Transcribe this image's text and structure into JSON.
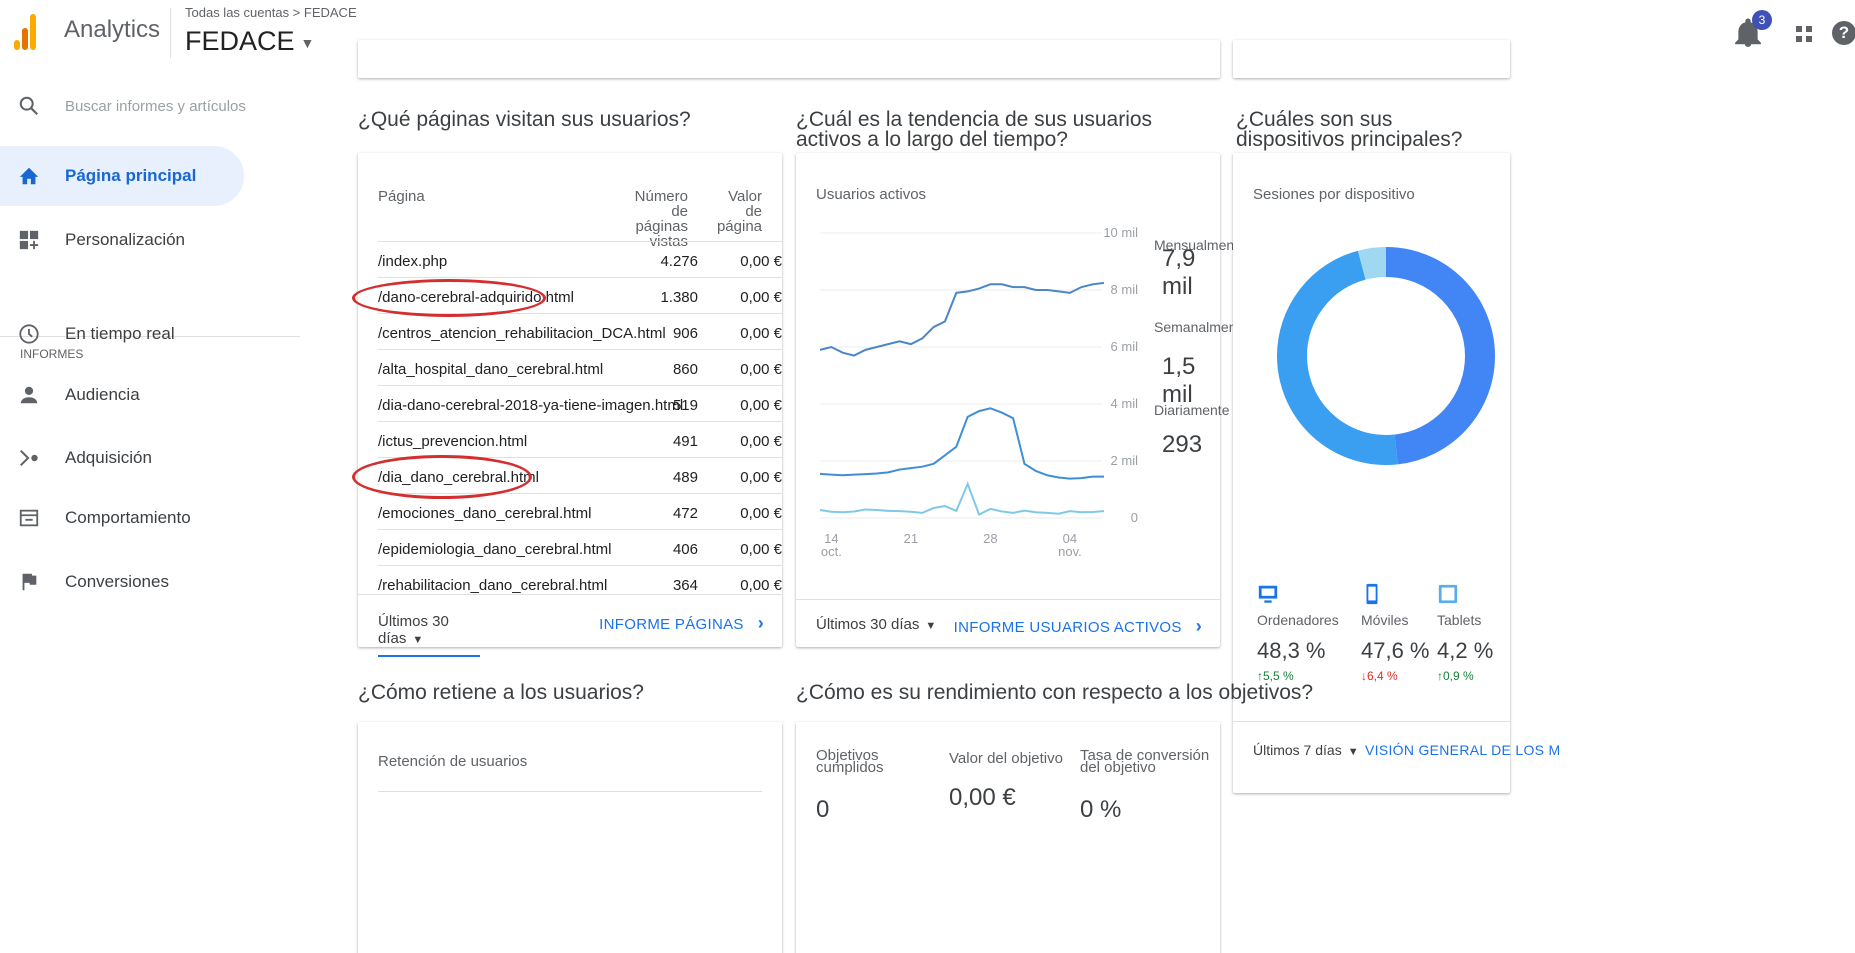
{
  "app": {
    "name": "Analytics",
    "breadcrumb": "Todas las cuentas > FEDACE",
    "account": "FEDACE",
    "notification_count": "3"
  },
  "sidebar": {
    "search_placeholder": "Buscar informes y artículos",
    "items": [
      {
        "label": "Página principal",
        "icon": "home-icon",
        "active": true
      },
      {
        "label": "Personalización",
        "icon": "dashboard-icon"
      }
    ],
    "section_label": "INFORMES",
    "reports": [
      {
        "label": "En tiempo real",
        "icon": "clock-icon"
      },
      {
        "label": "Audiencia",
        "icon": "person-icon"
      },
      {
        "label": "Adquisición",
        "icon": "acquisition-icon"
      },
      {
        "label": "Comportamiento",
        "icon": "behavior-icon"
      },
      {
        "label": "Conversiones",
        "icon": "flag-icon"
      }
    ]
  },
  "pages_card": {
    "question": "¿Qué páginas visitan sus usuarios?",
    "col_page": "Página",
    "col_views": "Número de páginas vistas",
    "col_value": "Valor de página",
    "rows": [
      {
        "page": "/index.php",
        "views": "4.276",
        "value": "0,00 €"
      },
      {
        "page": "/dano-cerebral-adquirido.html",
        "views": "1.380",
        "value": "0,00 €",
        "circled": true
      },
      {
        "page": "/centros_atencion_rehabilitacion_DCA.html",
        "views": "906",
        "value": "0,00 €"
      },
      {
        "page": "/alta_hospital_dano_cerebral.html",
        "views": "860",
        "value": "0,00 €"
      },
      {
        "page": "/dia-dano-cerebral-2018-ya-tiene-imagen.html",
        "views": "519",
        "value": "0,00 €"
      },
      {
        "page": "/ictus_prevencion.html",
        "views": "491",
        "value": "0,00 €"
      },
      {
        "page": "/dia_dano_cerebral.html",
        "views": "489",
        "value": "0,00 €",
        "circled": true
      },
      {
        "page": "/emociones_dano_cerebral.html",
        "views": "472",
        "value": "0,00 €"
      },
      {
        "page": "/epidemiologia_dano_cerebral.html",
        "views": "406",
        "value": "0,00 €"
      },
      {
        "page": "/rehabilitacion_dano_cerebral.html",
        "views": "364",
        "value": "0,00 €"
      }
    ],
    "range": "Últimos 30 días",
    "link": "INFORME PÁGINAS"
  },
  "active_card": {
    "question": "¿Cuál es la tendencia de sus usuarios activos a lo largo del tiempo?",
    "title": "Usuarios activos",
    "y_ticks": [
      "10 mil",
      "8 mil",
      "6 mil",
      "4 mil",
      "2 mil",
      "0"
    ],
    "x_ticks": [
      {
        "day": "14",
        "month": "oct."
      },
      {
        "day": "21",
        "month": ""
      },
      {
        "day": "28",
        "month": ""
      },
      {
        "day": "04",
        "month": "nov."
      }
    ],
    "metrics": [
      {
        "label": "Mensualmente",
        "value": "7,9 mil"
      },
      {
        "label": "Semanalmente",
        "value": "1,5 mil"
      },
      {
        "label": "Diariamente",
        "value": "293"
      }
    ],
    "range": "Últimos 30 días",
    "link": "INFORME USUARIOS ACTIVOS"
  },
  "chart_data": {
    "type": "line",
    "title": "Usuarios activos",
    "ylim": [
      0,
      10000
    ],
    "x": [
      13,
      14,
      15,
      16,
      17,
      18,
      19,
      20,
      21,
      22,
      23,
      24,
      25,
      26,
      27,
      28,
      29,
      30,
      31,
      1,
      2,
      3,
      4,
      5,
      6,
      7
    ],
    "x_ticks": [
      "14 oct.",
      "21",
      "28",
      "04 nov."
    ],
    "series": [
      {
        "name": "Mensualmente",
        "color": "#4a86c8",
        "values": [
          5900,
          6000,
          5800,
          5700,
          5900,
          6000,
          6100,
          6200,
          6100,
          6300,
          6700,
          6900,
          7900,
          7950,
          8050,
          8200,
          8200,
          8100,
          8100,
          8000,
          8000,
          7950,
          7900,
          8100,
          8200,
          8250
        ]
      },
      {
        "name": "Semanalmente",
        "color": "#3f8ed6",
        "values": [
          1550,
          1520,
          1500,
          1520,
          1540,
          1560,
          1600,
          1700,
          1750,
          1800,
          1900,
          2200,
          2500,
          3550,
          3750,
          3850,
          3700,
          3500,
          1900,
          1650,
          1500,
          1420,
          1380,
          1400,
          1450,
          1450
        ]
      },
      {
        "name": "Diariamente",
        "color": "#7fc8e8",
        "values": [
          280,
          220,
          200,
          230,
          300,
          280,
          250,
          240,
          220,
          180,
          350,
          420,
          250,
          1200,
          120,
          320,
          230,
          180,
          260,
          200,
          180,
          150,
          240,
          200,
          210,
          240
        ]
      }
    ]
  },
  "devices_card": {
    "question": "¿Cuáles son sus dispositivos principales?",
    "title": "Sesiones por dispositivo",
    "devices": [
      {
        "name": "Ordenadores",
        "pct": "48,3 %",
        "delta": "↑5,5 %",
        "delta_color": "#188038",
        "icon": "desktop-icon",
        "share": 48.3,
        "color": "#4285f4"
      },
      {
        "name": "Móviles",
        "pct": "47,6 %",
        "delta": "↓6,4 %",
        "delta_color": "#d93025",
        "icon": "mobile-icon",
        "share": 47.6,
        "color": "#3a9ff0"
      },
      {
        "name": "Tablets",
        "pct": "4,2 %",
        "delta": "↑0,9 %",
        "delta_color": "#188038",
        "icon": "tablet-icon",
        "share": 4.2,
        "color": "#9fd8f0"
      }
    ],
    "range": "Últimos 7 días",
    "link": "VISIÓN GENERAL DE LOS M"
  },
  "retention_card": {
    "question": "¿Cómo retiene a los usuarios?",
    "title": "Retención de usuarios"
  },
  "goals_card": {
    "question": "¿Cómo es su rendimiento con respecto a los objetivos?",
    "metrics": [
      {
        "label": "Objetivos cumplidos",
        "value": "0"
      },
      {
        "label": "Valor del objetivo",
        "value": "0,00 €"
      },
      {
        "label": "Tasa de conversión del objetivo",
        "value": "0 %"
      }
    ]
  }
}
